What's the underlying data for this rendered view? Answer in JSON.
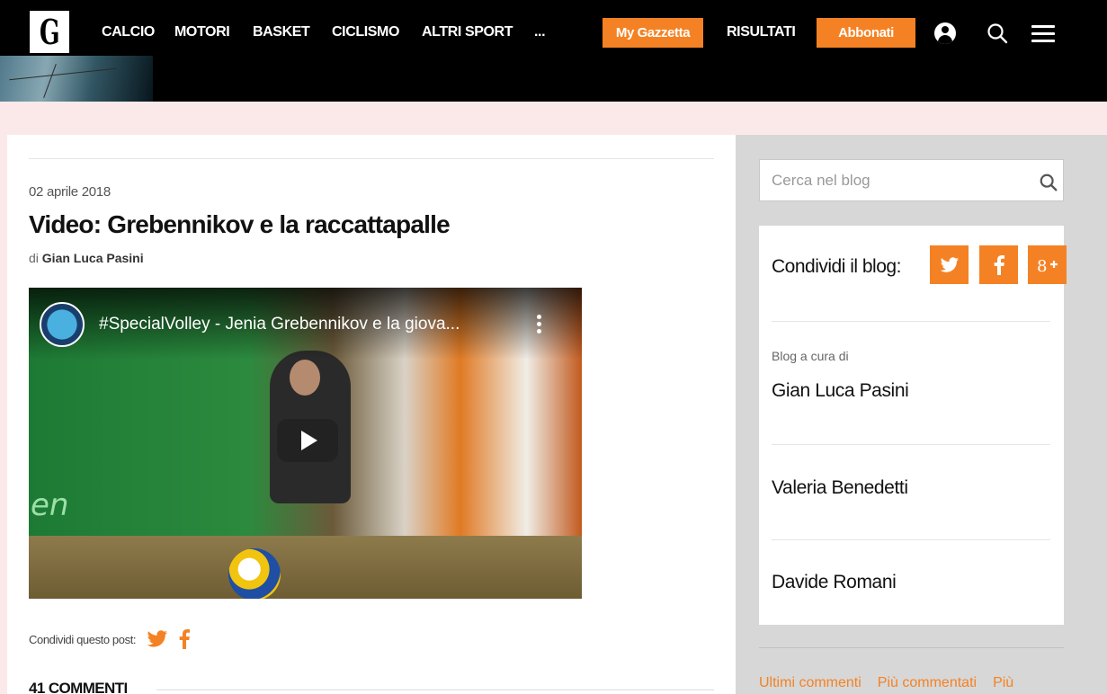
{
  "header": {
    "logo_letter": "G",
    "nav": [
      "CALCIO",
      "MOTORI",
      "BASKET",
      "CICLISMO",
      "ALTRI SPORT",
      "..."
    ],
    "my_gazzetta": "My Gazzetta",
    "risultati": "RISULTATI",
    "abbonati": "Abbonati",
    "accent_color": "#f48224"
  },
  "post": {
    "date": "02 aprile 2018",
    "title": "Video: Grebennikov e la raccattapalle",
    "byline_prefix": "di",
    "author": "Gian Luca Pasini",
    "video_title": "#SpecialVolley - Jenia Grebennikov e la giova...",
    "video_overlay_text": "en",
    "share_label": "Condividi questo post:",
    "comments_count": "41 COMMENTI"
  },
  "sidebar": {
    "search_placeholder": "Cerca nel blog",
    "share_blog_label": "Condividi il blog:",
    "curated_label": "Blog a cura di",
    "authors": [
      "Gian Luca Pasini",
      "Valeria Benedetti",
      "Davide Romani"
    ],
    "tabs": [
      "Ultimi commenti",
      "Più commentati",
      "Più"
    ]
  }
}
